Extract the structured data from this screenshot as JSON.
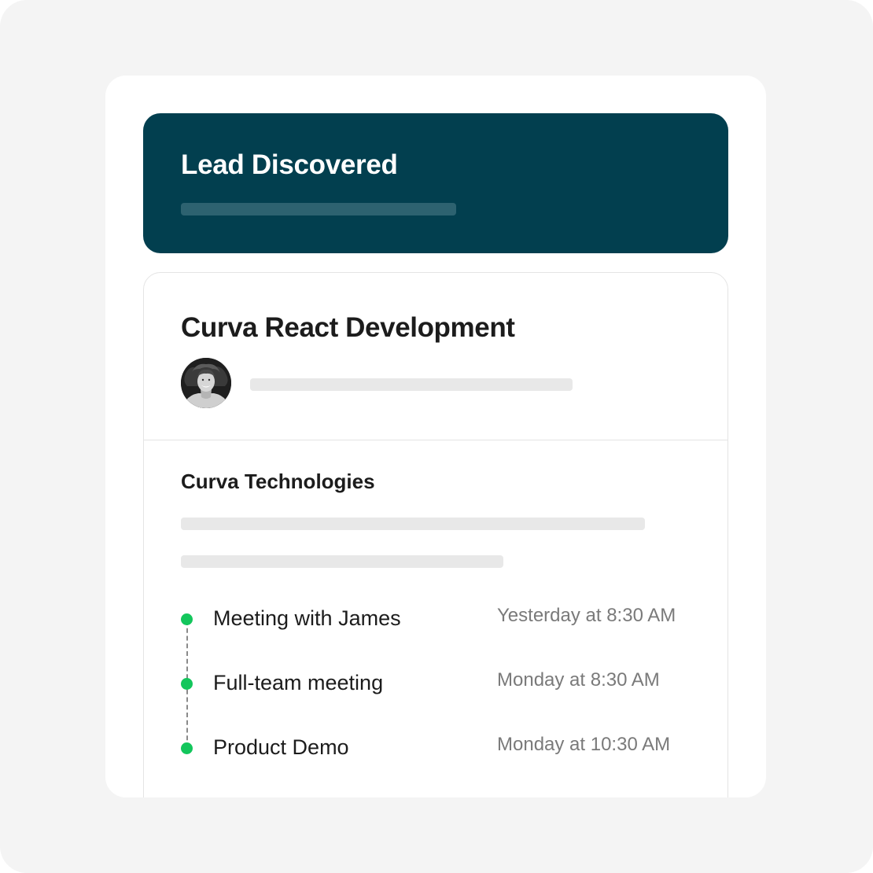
{
  "header": {
    "title": "Lead Discovered",
    "background": "#023f4f"
  },
  "deal": {
    "title": "Curva React Development",
    "avatar_icon": "user-photo-avatar"
  },
  "company": {
    "name": "Curva Technologies"
  },
  "timeline": {
    "dot_color": "#13c65c",
    "events": [
      {
        "title": "Meeting with James",
        "time": "Yesterday at 8:30 AM"
      },
      {
        "title": "Full-team meeting",
        "time": "Monday at 8:30 AM"
      },
      {
        "title": "Product Demo",
        "time": "Monday at 10:30 AM"
      }
    ]
  }
}
